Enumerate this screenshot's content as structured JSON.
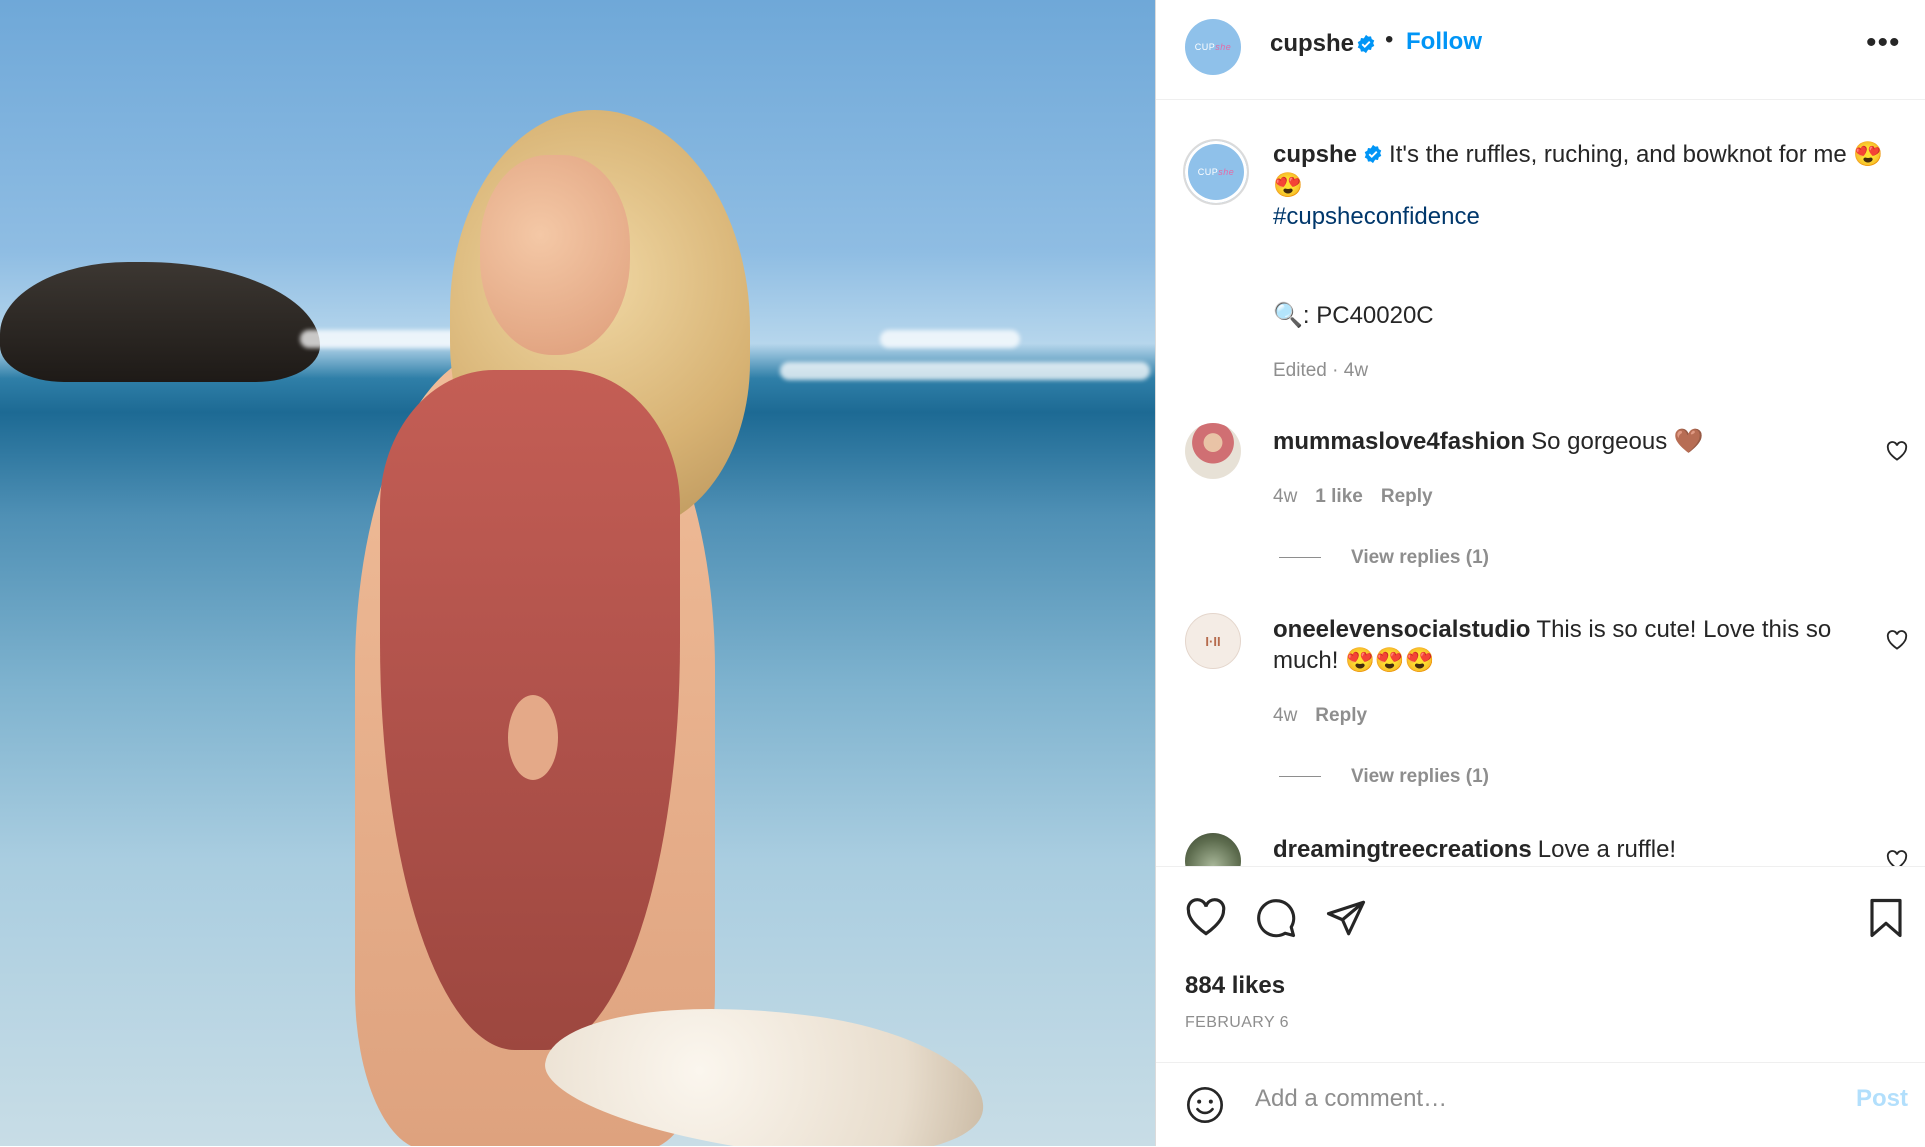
{
  "post": {
    "username": "cupshe",
    "follow_label": "Follow",
    "separator": "•",
    "more_label": "•••",
    "avatar_text": "CUP",
    "avatar_text_script": "she"
  },
  "caption": {
    "username": "cupshe",
    "text": "It's the ruffles, ruching, and bowknot for me 😍",
    "emoji_line2": "😍",
    "hashtag": "#cupsheconfidence",
    "product_icon": "🔍",
    "product_code": ": PC40020C",
    "meta": "Edited · 4w"
  },
  "comments": [
    {
      "username": "mummaslove4fashion",
      "text": "So gorgeous",
      "emoji": "🤎",
      "age": "4w",
      "likes": "1 like",
      "reply": "Reply",
      "view_replies": "View replies (1)"
    },
    {
      "username": "oneelevensocialstudio",
      "text": "This is so cute! Love this so",
      "text2": "much!",
      "emoji": "😍😍😍",
      "avatar_text": "I·II",
      "age": "4w",
      "reply": "Reply",
      "view_replies": "View replies (1)"
    },
    {
      "username": "dreamingtreecreations",
      "text": "Love a ruffle!"
    }
  ],
  "stats": {
    "likes": "884 likes",
    "date": "FEBRUARY 6"
  },
  "composer": {
    "placeholder": "Add a comment…",
    "post_label": "Post"
  },
  "colors": {
    "accent": "#0095f6",
    "hashtag": "#00376b",
    "muted": "#8e8e8e",
    "post_disabled": "#b2dffc"
  }
}
